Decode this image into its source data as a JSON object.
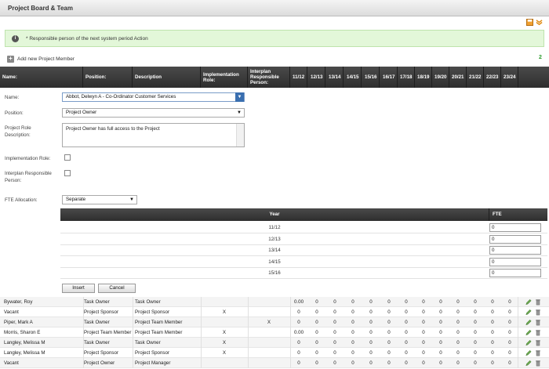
{
  "window": {
    "title": "Project Board & Team"
  },
  "info_message": "* Responsible person of the next system period Action",
  "add_member": {
    "label": "Add new Project Member",
    "count": "2"
  },
  "table_headers": {
    "name": "Name:",
    "position": "Position:",
    "description": "Description",
    "impl_role": "Implementation Role:",
    "interplan": "Interplan Responsible Person:",
    "years": [
      "11/12",
      "12/13",
      "13/14",
      "14/15",
      "15/16",
      "16/17",
      "17/18",
      "18/19",
      "19/20",
      "20/21",
      "21/22",
      "22/23",
      "23/24"
    ]
  },
  "form": {
    "name_label": "Name:",
    "name_value": "Abbot, Delwyn A - Co-Ordinator Customer Services",
    "position_label": "Position:",
    "position_value": "Project Owner",
    "role_desc_label_1": "Project Role",
    "role_desc_label_2": "Description:",
    "role_desc_value": "Project Owner has full access to the Project",
    "impl_role_label": "Implementation Role:",
    "interplan_label_1": "Interplan Responsible",
    "interplan_label_2": "Person:",
    "fte_alloc_label": "FTE Allocation:",
    "fte_alloc_value": "Separate",
    "fte_table": {
      "year_header": "Year",
      "fte_header": "FTE",
      "rows": [
        {
          "year": "11/12",
          "fte": "0"
        },
        {
          "year": "12/13",
          "fte": "0"
        },
        {
          "year": "13/14",
          "fte": "0"
        },
        {
          "year": "14/15",
          "fte": "0"
        },
        {
          "year": "15/16",
          "fte": "0"
        }
      ]
    },
    "insert_label": "Insert",
    "cancel_label": "Cancel"
  },
  "members": [
    {
      "name": "Bywater, Roy",
      "position": "Task Owner",
      "description": "Task Owner",
      "impl": "",
      "interplan": "",
      "first": "0.00"
    },
    {
      "name": "Vacant",
      "position": "Project Sponsor",
      "description": "Project Sponsor",
      "impl": "X",
      "interplan": "",
      "first": "0"
    },
    {
      "name": "Piper, Mark A",
      "position": "Task Owner",
      "description": "Project Team Member",
      "impl": "",
      "interplan": "X",
      "first": "0"
    },
    {
      "name": "Morris, Sharon E",
      "position": "Project Team Member",
      "description": "Project Team Member",
      "impl": "X",
      "interplan": "",
      "first": "0.00"
    },
    {
      "name": "Langley, Melissa M",
      "position": "Task Owner",
      "description": "Task Owner",
      "impl": "X",
      "interplan": "",
      "first": "0"
    },
    {
      "name": "Langley, Melissa M",
      "position": "Project Sponsor",
      "description": "Project Sponsor",
      "impl": "X",
      "interplan": "",
      "first": "0"
    },
    {
      "name": "Vacant",
      "position": "Project Owner",
      "description": "Project Manager",
      "impl": "",
      "interplan": "",
      "first": "0"
    }
  ],
  "year_zero": "0",
  "colors": {
    "header_bg": "#333333",
    "info_bg": "#e3f7d9",
    "count_green": "#2a9a2a",
    "select_blue": "#3a6fb0"
  }
}
